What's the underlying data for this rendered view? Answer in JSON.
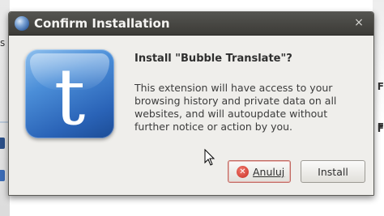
{
  "background": {
    "left_text": "s",
    "right_letters": [
      "F",
      "F",
      "F"
    ]
  },
  "dialog": {
    "title": "Confirm Installation",
    "close_symbol": "×",
    "heading": "Install \"Bubble Translate\"?",
    "description": "This extension will have access to your browsing history and private data on all websites, and will autoupdate without further notice or action by you.",
    "app_icon_letter": "t",
    "cancel_label": "Anuluj",
    "install_label": "Install",
    "icons": {
      "title": "browser-logo-icon",
      "app": "bubble-translate-icon",
      "cancel": "cancel-x-icon"
    },
    "colors": {
      "titlebar": "#3c3b37",
      "dialog_bg": "#efeeeb",
      "app_icon_blue": "#2a63b7",
      "cancel_red": "#c92d22"
    }
  }
}
